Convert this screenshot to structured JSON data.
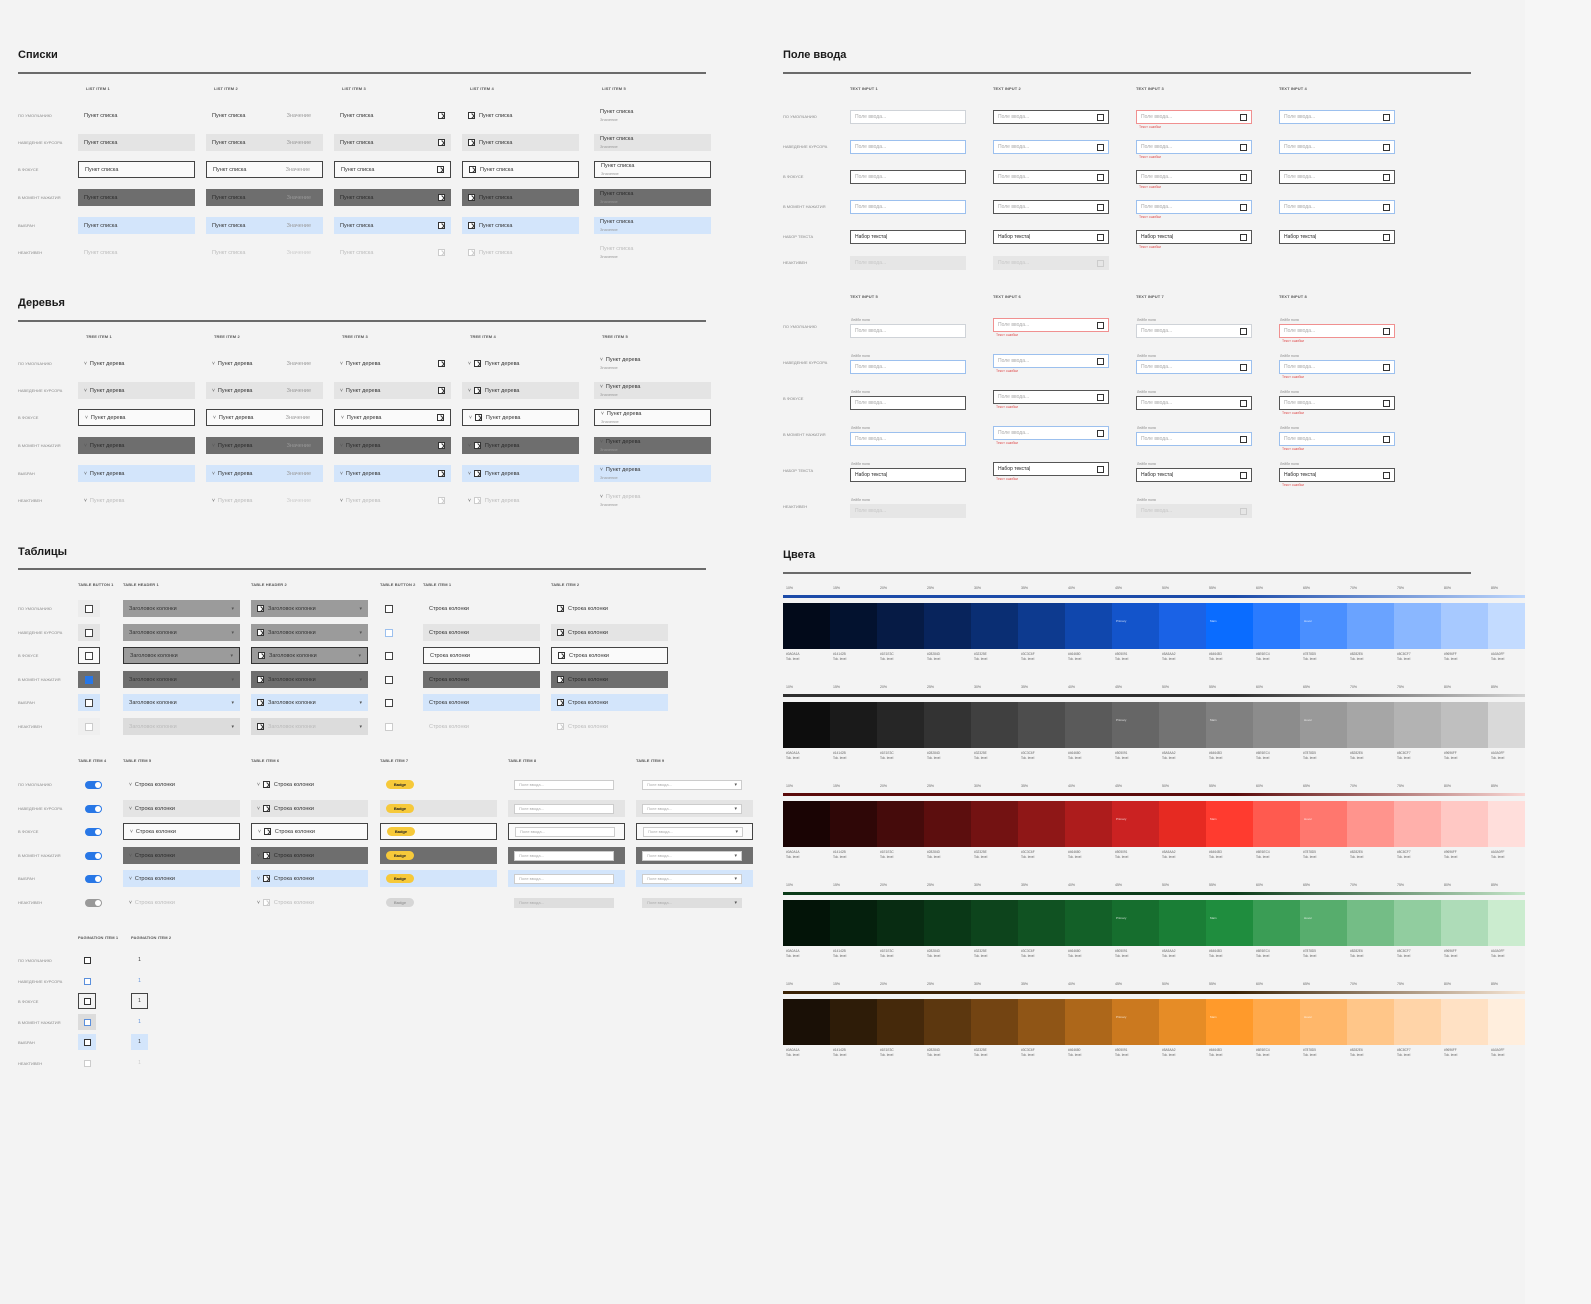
{
  "sections": {
    "lists": "Списки",
    "trees": "Деревья",
    "tables": "Таблицы",
    "input": "Поле ввода",
    "colors": "Цвета"
  },
  "states": [
    "ПО УМОЛЧАНИЮ",
    "НАВЕДЕНИЕ КУРСОРА",
    "В ФОКУСЕ",
    "В МОМЕНТ НАЖАТИЯ",
    "ВЫБРАН",
    "НЕАКТИВЕН"
  ],
  "input_states": [
    "ПО УМОЛЧАНИЮ",
    "НАВЕДЕНИЕ КУРСОРА",
    "В ФОКУСЕ",
    "В МОМЕНТ НАЖАТИЯ",
    "НАБОР ТЕКСТА",
    "НЕАКТИВЕН"
  ],
  "lists": {
    "cols": [
      "LIST ITEM 1",
      "LIST ITEM 2",
      "LIST ITEM 3",
      "LIST ITEM 4",
      "LIST ITEM 5"
    ],
    "item": "Пункт списка",
    "value": "Значение",
    "sub": "Значение"
  },
  "trees": {
    "cols": [
      "TREE ITEM 1",
      "TREE ITEM 2",
      "TREE ITEM 3",
      "TREE ITEM 4",
      "TREE ITEM 5"
    ],
    "item": "Пункт дерева",
    "value": "Значение",
    "sub": "Значение"
  },
  "inputs": {
    "cols_top": [
      "TEXT INPUT 1",
      "TEXT INPUT 2",
      "TEXT INPUT 3",
      "TEXT INPUT 4"
    ],
    "cols_bottom": [
      "TEXT INPUT 5",
      "TEXT INPUT 6",
      "TEXT INPUT 7",
      "TEXT INPUT 8"
    ],
    "placeholder": "Поле ввода...",
    "typed": "Набор текста|",
    "error": "Текст ошибки",
    "label": "Лейбл поля"
  },
  "tables": {
    "cols_top": [
      "TABLE BUTTON 1",
      "TABLE HEADER 1",
      "TABLE HEADER 2",
      "TABLE BUTTON 2",
      "TABLE ITEM 1",
      "TABLE ITEM 2"
    ],
    "cols_mid": [
      "TABLE ITEM 4",
      "TABLE ITEM 5",
      "TABLE ITEM 6",
      "TABLE ITEM 7",
      "TABLE ITEM 8",
      "TABLE ITEM 9"
    ],
    "cols_bottom": [
      "PAGINATION ITEM 1",
      "PAGINATION ITEM 2"
    ],
    "header": "Заголовок колонки",
    "row": "Строка колонки",
    "badge": "Badge",
    "placeholder": "Поле ввода...",
    "page": "1"
  },
  "palette": {
    "steps": [
      "10%",
      "15%",
      "20%",
      "25%",
      "30%",
      "35%",
      "40%",
      "45%",
      "50%",
      "55%",
      "60%",
      "65%",
      "70%",
      "75%",
      "80%",
      "85%"
    ],
    "tags": [
      "Primary",
      "Main",
      "Hover"
    ],
    "ramps": [
      {
        "name": "blue",
        "strip": "#1b4aa8",
        "colors": [
          "#020a1a",
          "#03122f",
          "#061b45",
          "#08245c",
          "#0a2e73",
          "#0d3a8f",
          "#1047ad",
          "#1354cb",
          "#1a62e6",
          "#0a6cff",
          "#2a7bff",
          "#4a8fff",
          "#6aa3ff",
          "#8ab7ff",
          "#a7c9ff",
          "#c3dbff"
        ]
      },
      {
        "name": "gray",
        "strip": "#2e2e2e",
        "colors": [
          "#0d0d0d",
          "#1a1a1a",
          "#262626",
          "#333333",
          "#404040",
          "#4d4d4d",
          "#5a5a5a",
          "#666666",
          "#737373",
          "#808080",
          "#8c8c8c",
          "#999999",
          "#a6a6a6",
          "#b3b3b3",
          "#bfbfbf",
          "#d9d9d9"
        ]
      },
      {
        "name": "red",
        "strip": "#5a0a0a",
        "colors": [
          "#1a0404",
          "#2f0707",
          "#450b0b",
          "#5c0e0e",
          "#731212",
          "#8f1717",
          "#ad1c1c",
          "#cb2222",
          "#e62a22",
          "#ff3b2f",
          "#ff5a4f",
          "#ff776e",
          "#ff948d",
          "#ffb0ab",
          "#ffc8c4",
          "#ffdedb"
        ]
      },
      {
        "name": "green",
        "strip": "#0a3a18",
        "colors": [
          "#031408",
          "#05200d",
          "#082c12",
          "#0a3817",
          "#0d441c",
          "#105222",
          "#136028",
          "#166e2e",
          "#1a7e36",
          "#1f8d3e",
          "#3a9d55",
          "#57ad6d",
          "#74bd86",
          "#91cd9f",
          "#aedcb8",
          "#cbeccf"
        ]
      },
      {
        "name": "orange",
        "strip": "#3a2205",
        "colors": [
          "#1a1006",
          "#2e1c08",
          "#45290b",
          "#5c370f",
          "#734412",
          "#8f5516",
          "#ad671a",
          "#cb791f",
          "#e68c26",
          "#ff9a2b",
          "#ffa94b",
          "#ffb76a",
          "#ffc689",
          "#ffd4a8",
          "#ffe1c4",
          "#ffeedd"
        ]
      }
    ],
    "code_label": "Tok. level",
    "hex_labels": [
      "#0A0A1A",
      "#14142B",
      "#1E1E3C",
      "#28284D",
      "#32325E",
      "#3C3C6F",
      "#464680",
      "#505091",
      "#5A5AA2",
      "#6464B3",
      "#6E6EC4",
      "#7878D5",
      "#8282E6",
      "#8C8CF7",
      "#9696FF",
      "#A0A0FF"
    ]
  }
}
